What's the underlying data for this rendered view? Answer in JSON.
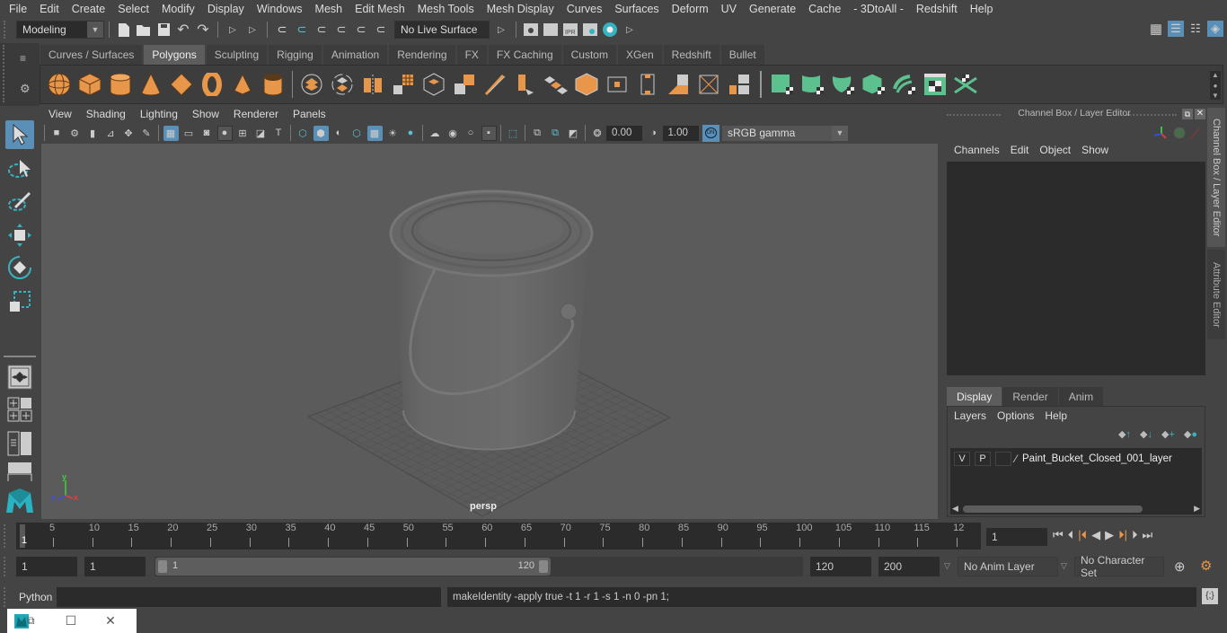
{
  "menubar": {
    "items": [
      "File",
      "Edit",
      "Create",
      "Select",
      "Modify",
      "Display",
      "Windows",
      "Mesh",
      "Edit Mesh",
      "Mesh Tools",
      "Mesh Display",
      "Curves",
      "Surfaces",
      "Deform",
      "UV",
      "Generate",
      "Cache",
      "- 3DtoAll -",
      "Redshift",
      "Help"
    ]
  },
  "statusline": {
    "workspace_mode": "Modeling",
    "live_surface": "No Live Surface"
  },
  "shelf": {
    "tabs": [
      "Curves / Surfaces",
      "Polygons",
      "Sculpting",
      "Rigging",
      "Animation",
      "Rendering",
      "FX",
      "FX Caching",
      "Custom",
      "XGen",
      "Redshift",
      "Bullet"
    ],
    "active_tab": "Polygons",
    "icons_orange": [
      "poly-sphere-icon",
      "poly-cube-icon",
      "poly-cylinder-icon",
      "poly-cone-icon",
      "poly-diamond-icon",
      "poly-torus-icon",
      "poly-pyramid-icon",
      "poly-pipe-icon"
    ],
    "icons_tools": [
      "combine-icon",
      "separate-icon",
      "mirror-icon",
      "smooth-icon",
      "extract-icon",
      "boolean-icon",
      "multi-cut-icon",
      "extrude-icon",
      "bridge-icon",
      "bevel-icon",
      "insert-edge-loop-icon",
      "append-to-polygon-icon",
      "fill-hole-icon",
      "merge-icon",
      "target-weld-icon"
    ],
    "icons_green": [
      "planar-uv-icon",
      "cylindrical-uv-icon",
      "spherical-uv-icon",
      "automatic-uv-icon",
      "unfold-uv-icon",
      "uv-editor-icon",
      "cut-uv-icon"
    ]
  },
  "viewport": {
    "menus": [
      "View",
      "Shading",
      "Lighting",
      "Show",
      "Renderer",
      "Panels"
    ],
    "exposure": "0.00",
    "gamma": "1.00",
    "color_mgmt_badge": "ON",
    "color_space": "sRGB gamma",
    "camera_label": "persp",
    "axis": {
      "x": "x",
      "y": "y",
      "z": "z"
    },
    "colors": {
      "x": "#e04040",
      "y": "#40d040",
      "z": "#4050e0"
    }
  },
  "channel_box": {
    "title": "Channel Box / Layer Editor",
    "menus": [
      "Channels",
      "Edit",
      "Object",
      "Show"
    ],
    "display_tabs": [
      "Display",
      "Render",
      "Anim"
    ],
    "active_display_tab": "Display",
    "layer_menus": [
      "Layers",
      "Options",
      "Help"
    ],
    "layers": [
      {
        "v": "V",
        "p": "P",
        "name": "Paint_Bucket_Closed_001_layer"
      }
    ]
  },
  "side_tabs": {
    "channel_box": "Channel Box / Layer Editor",
    "attribute_editor": "Attribute Editor"
  },
  "timeline": {
    "ticks": [
      "5",
      "10",
      "15",
      "20",
      "25",
      "30",
      "35",
      "40",
      "45",
      "50",
      "55",
      "60",
      "65",
      "70",
      "75",
      "80",
      "85",
      "90",
      "95",
      "100",
      "105",
      "110",
      "115",
      "12"
    ],
    "current_frame_marker": "1",
    "current_frame": "1"
  },
  "range": {
    "start_time": "1",
    "playback_start": "1",
    "slider_start": "1",
    "slider_end": "120",
    "playback_end": "120",
    "end_time": "200",
    "anim_layer": "No Anim Layer",
    "character_set": "No Character Set"
  },
  "command": {
    "language": "Python",
    "input": "",
    "result": "makeIdentity -apply true -t 1 -r 1 -s 1 -n 0 -pn 1;"
  },
  "accent": {
    "blue": "#5a8fb8",
    "orange": "#e8964a",
    "green": "#5cc08f",
    "teal": "#36b3c0"
  }
}
